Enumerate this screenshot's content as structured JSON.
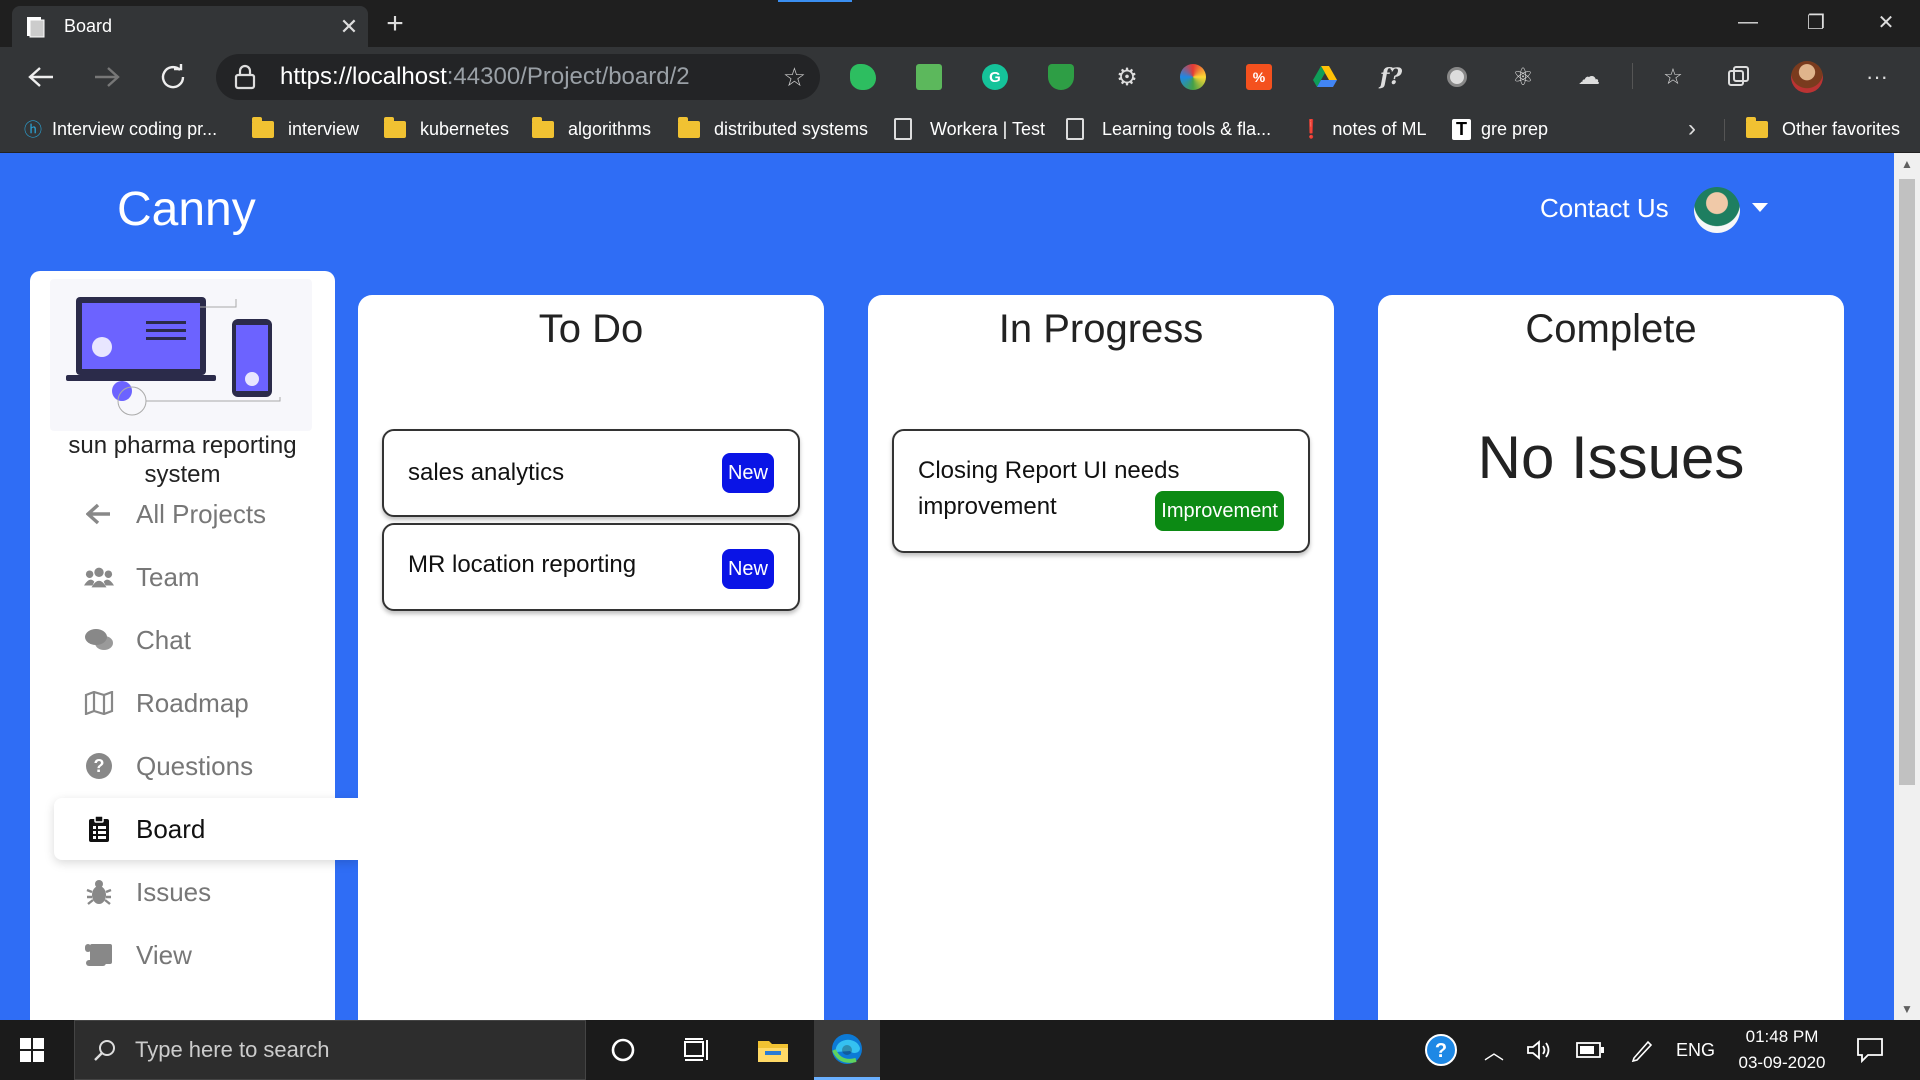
{
  "browser": {
    "tab_title": "Board",
    "tab_close": "✕",
    "new_tab": "+",
    "url_host": "https://localhost",
    "url_rest": ":44300/Project/board/2",
    "more": "···",
    "window": {
      "minimize": "—",
      "restore": "❐",
      "close": "✕"
    }
  },
  "bookmarks": [
    {
      "label": "Interview coding pr...",
      "icon": "bookmark-site-icon"
    },
    {
      "label": "interview",
      "icon": "folder-icon"
    },
    {
      "label": "kubernetes",
      "icon": "folder-icon"
    },
    {
      "label": "algorithms",
      "icon": "folder-icon"
    },
    {
      "label": "distributed systems",
      "icon": "folder-icon"
    },
    {
      "label": "Workera | Test",
      "icon": "page-icon"
    },
    {
      "label": "Learning tools & fla...",
      "icon": "page-icon"
    },
    {
      "label": "notes of ML",
      "icon": "bookmark-site-icon"
    },
    {
      "label": "gre prep",
      "icon": "bookmark-site-icon"
    }
  ],
  "bookmarks_other": "Other favorites",
  "app": {
    "brand": "Canny",
    "contact": "Contact Us",
    "project_name": "sun pharma reporting system",
    "nav": [
      {
        "label": "All Projects",
        "icon": "arrow-left-icon"
      },
      {
        "label": "Team",
        "icon": "users-icon"
      },
      {
        "label": "Chat",
        "icon": "chat-icon"
      },
      {
        "label": "Roadmap",
        "icon": "map-icon"
      },
      {
        "label": "Questions",
        "icon": "question-icon"
      },
      {
        "label": "Board",
        "icon": "clipboard-icon",
        "active": true
      },
      {
        "label": "Issues",
        "icon": "bug-icon"
      },
      {
        "label": "View",
        "icon": "scroll-icon"
      }
    ]
  },
  "board": {
    "columns": [
      {
        "title": "To Do",
        "cards": [
          {
            "title": "sales analytics",
            "badge": "New"
          },
          {
            "title": "MR location reporting",
            "badge": "New"
          }
        ]
      },
      {
        "title": "In Progress",
        "cards": [
          {
            "title": "Closing Report UI needs improvement",
            "badge": "Improvement"
          }
        ]
      },
      {
        "title": "Complete",
        "empty_text": "No Issues"
      }
    ]
  },
  "taskbar": {
    "search_placeholder": "Type here to search",
    "language": "ENG",
    "time": "01:48 PM",
    "date": "03-09-2020"
  },
  "colors": {
    "page_background": "#2f6df5",
    "badge_new": "#0a14e6",
    "badge_improvement": "#0c8a14"
  }
}
